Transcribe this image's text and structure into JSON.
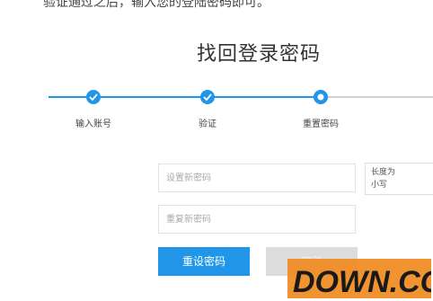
{
  "intro_text": "验证通过之后，输入您的登陆密码即可。",
  "page": {
    "title": "找回登录密码"
  },
  "steps": [
    {
      "label": "输入账号",
      "status": "done"
    },
    {
      "label": "验证",
      "status": "done"
    },
    {
      "label": "重置密码",
      "status": "current"
    }
  ],
  "form": {
    "new_password_placeholder": "设置新密码",
    "confirm_password_placeholder": "重复新密码",
    "hint_line1": "长度为",
    "hint_line2": "小写"
  },
  "buttons": {
    "reset_label": "重设密码",
    "secondary_label": "取消"
  },
  "watermark": {
    "text": "DOWN.CC"
  },
  "colors": {
    "accent": "#2196e8",
    "watermark_orange": "#f08a1e"
  }
}
